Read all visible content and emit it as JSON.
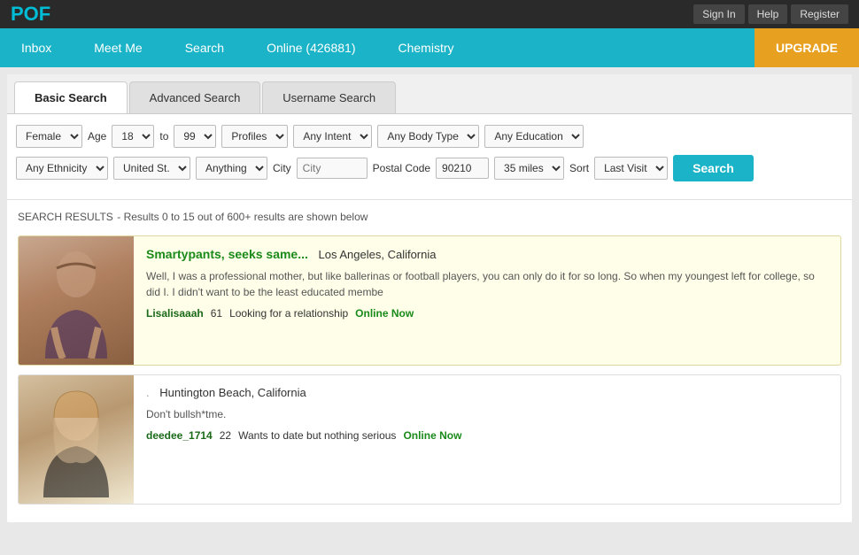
{
  "site": {
    "logo": "POF",
    "topnav": {
      "signin": "Sign In",
      "help": "Help",
      "register": "Register"
    }
  },
  "mainnav": {
    "inbox": "Inbox",
    "meetme": "Meet Me",
    "search": "Search",
    "online": "Online (426881)",
    "chemistry": "Chemistry",
    "upgrade": "UPGRADE"
  },
  "tabs": {
    "basic": "Basic Search",
    "advanced": "Advanced Search",
    "username": "Username Search"
  },
  "filters": {
    "gender": "Female",
    "age_label": "Age",
    "age_from": "18",
    "age_to": "99",
    "to_label": "to",
    "profiles": "Profiles",
    "intent": "Any Intent",
    "body_type": "Any Body Type",
    "education": "Any Education",
    "ethnicity": "Any Ethnicity",
    "country": "United St.",
    "anything": "Anything",
    "city_placeholder": "City",
    "postal_label": "Postal Code",
    "postal_code": "90210",
    "distance": "35 miles",
    "sort_label": "Sort",
    "sort_value": "Last Visit",
    "search_btn": "Search"
  },
  "results": {
    "header": "SEARCH RESULTS",
    "subtitle": "- Results 0 to 15 out of 600+ results are shown below",
    "cards": [
      {
        "title": "Smartypants, seeks same...",
        "location": "Los Angeles, California",
        "description": "Well, I was a professional mother, but like ballerinas or football players, you can only do it for so long. So when my youngest left for college, so did I. I didn't want to be the least educated membe",
        "username": "Lisalisaaah",
        "age": "61",
        "status": "Looking for a relationship",
        "online": "Online Now",
        "highlight": true
      },
      {
        "title": ".",
        "location": "Huntington Beach, California",
        "description": "Don't bullsh*tme.",
        "username": "deedee_1714",
        "age": "22",
        "status": "Wants to date but nothing serious",
        "online": "Online Now",
        "highlight": false
      }
    ]
  }
}
